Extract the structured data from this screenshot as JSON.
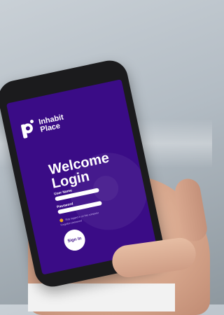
{
  "app": {
    "logo_line1": "Inhabit",
    "logo_line2": "Place"
  },
  "login": {
    "title_line1": "Welcome",
    "title_line2": "Login",
    "username_label": "User Name",
    "password_label": "Password",
    "remember_label": "Stay logged in on this computer",
    "forgot_label": "Forgotten password",
    "signin_label": "Sign In"
  },
  "colors": {
    "screen_background": "#3a0c86",
    "checkbox_accent": "#e8a41a"
  },
  "icons": {
    "logo": "inhabit-place-logo-icon"
  }
}
